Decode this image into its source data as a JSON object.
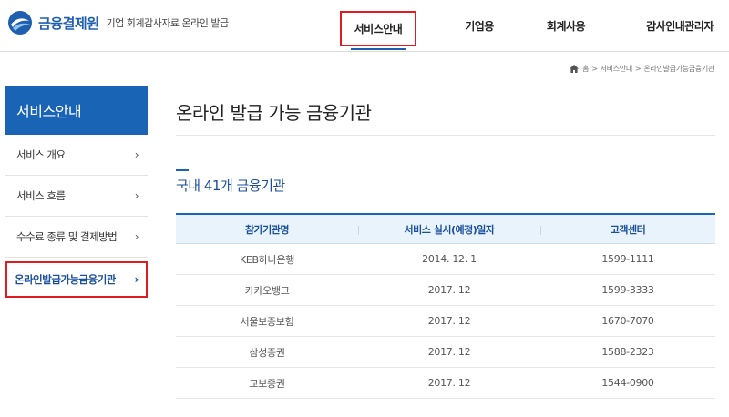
{
  "header": {
    "logo_name": "금융결제원",
    "logo_sub": "기업 회계감사자료 온라인 발급",
    "nav": [
      {
        "label": "서비스안내",
        "active": true
      },
      {
        "label": "기업용",
        "active": false
      },
      {
        "label": "회계사용",
        "active": false
      },
      {
        "label": "감사인내관리자",
        "active": false
      }
    ]
  },
  "breadcrumb": {
    "home_icon": "home-icon",
    "items": [
      "홈",
      "서비스안내",
      "온라인발급가능금융기관"
    ],
    "separator": ">"
  },
  "sidebar": {
    "title": "서비스안내",
    "items": [
      {
        "label": "서비스 개요",
        "active": false
      },
      {
        "label": "서비스 흐름",
        "active": false
      },
      {
        "label": "수수료 종류 및 결제방법",
        "active": false
      },
      {
        "label": "온라인발급가능금융기관",
        "active": true
      }
    ],
    "chevron": "›"
  },
  "main": {
    "page_title": "온라인 발급 가능 금융기관",
    "section_title": "국내 41개 금융기관",
    "table": {
      "headers": [
        "참가기관명",
        "서비스 실시(예정)일자",
        "고객센터"
      ],
      "rows": [
        [
          "KEB하나은행",
          "2014. 12. 1",
          "1599-1111"
        ],
        [
          "카카오뱅크",
          "2017. 12",
          "1599-3333"
        ],
        [
          "서울보증보험",
          "2017. 12",
          "1670-7070"
        ],
        [
          "삼성증권",
          "2017. 12",
          "1588-2323"
        ],
        [
          "교보증권",
          "2017. 12",
          "1544-0900"
        ]
      ]
    }
  },
  "colors": {
    "brand_blue": "#1a64b6",
    "highlight_red": "#e01c22",
    "table_header_bg": "#e8f3fb"
  }
}
